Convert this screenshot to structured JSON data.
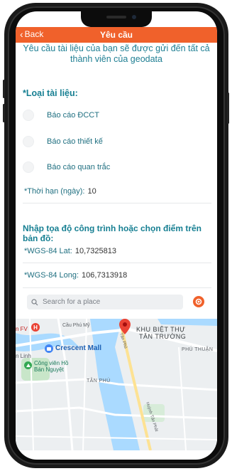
{
  "header": {
    "back_label": "Back",
    "title": "Yêu cầu"
  },
  "intro_text": "Yêu cầu tài liệu của bạn sẽ được gửi đến tất cả thành viên của geodata",
  "doc_type": {
    "title": "*Loại tài liệu:",
    "options": [
      {
        "label": "Báo cáo ĐCCT",
        "selected": false
      },
      {
        "label": "Báo cáo thiết kế",
        "selected": false
      },
      {
        "label": "Báo cáo quan trắc",
        "selected": false
      }
    ]
  },
  "deadline": {
    "label": "*Thời hạn (ngày):",
    "value": "10"
  },
  "coords_title": "Nhập tọa độ công trình hoặc chọn điểm trên bản đồ:",
  "lat": {
    "label": "*WGS-84 Lat:",
    "value": "10,7325813"
  },
  "long": {
    "label": "*WGS-84 Long:",
    "value": "106,7313918"
  },
  "search": {
    "placeholder": "Search for a place",
    "icon": "search-icon"
  },
  "map": {
    "labels": {
      "fv": "n FV",
      "cau_phu_my": "Cầu Phú Mỹ",
      "khu_biet_thu_1": "KHU BIỆT THỰ",
      "khu_biet_thu_2": "TÂN TRƯỜNG",
      "crescent": "Crescent Mall",
      "phu_thuan": "PHÚ THUẬN",
      "linh": "n Linh",
      "cong_vien_1": "Công viên Hồ",
      "cong_vien_2": "Bán Nguyệt",
      "tan_phu": "TÂN PHÚ",
      "road1": "Tân Phú",
      "road2": "Huỳnh Tấn Phát"
    },
    "colors": {
      "water": "#aadaff",
      "park": "#c8e6c9",
      "road": "#ffffff",
      "pin": "#ea4335"
    }
  },
  "colors": {
    "accent": "#f0612b",
    "teal": "#167f92"
  }
}
